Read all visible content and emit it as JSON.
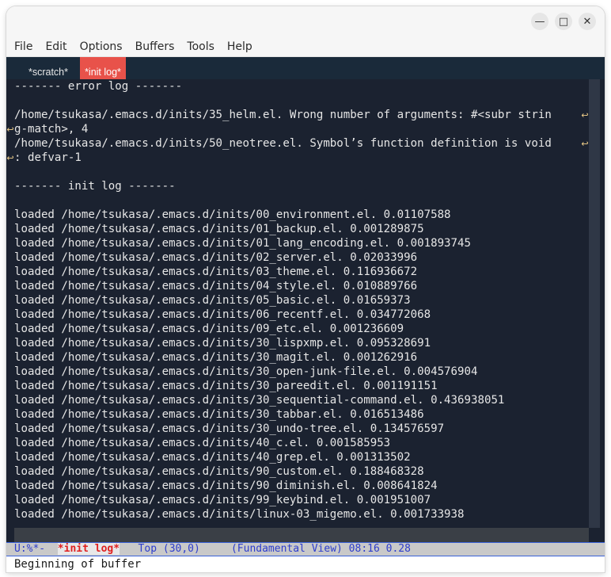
{
  "window": {
    "minimize_icon": "minimize-icon",
    "maximize_icon": "maximize-icon",
    "close_icon": "close-icon"
  },
  "menu": [
    "File",
    "Edit",
    "Options",
    "Buffers",
    "Tools",
    "Help"
  ],
  "tabs": [
    {
      "label": "*scratch*",
      "active": false
    },
    {
      "label": "*init log*",
      "active": true
    }
  ],
  "buffer": {
    "lines": [
      "------- error log -------",
      "",
      "/home/tsukasa/.emacs.d/inits/35_helm.el. Wrong number of arguments: #<subr strin",
      "g-match>, 4",
      "/home/tsukasa/.emacs.d/inits/50_neotree.el. Symbol’s function definition is void",
      ": defvar-1",
      "",
      "------- init log -------",
      "",
      "loaded /home/tsukasa/.emacs.d/inits/00_environment.el. 0.01107588",
      "loaded /home/tsukasa/.emacs.d/inits/01_backup.el. 0.001289875",
      "loaded /home/tsukasa/.emacs.d/inits/01_lang_encoding.el. 0.001893745",
      "loaded /home/tsukasa/.emacs.d/inits/02_server.el. 0.02033996",
      "loaded /home/tsukasa/.emacs.d/inits/03_theme.el. 0.116936672",
      "loaded /home/tsukasa/.emacs.d/inits/04_style.el. 0.010889766",
      "loaded /home/tsukasa/.emacs.d/inits/05_basic.el. 0.01659373",
      "loaded /home/tsukasa/.emacs.d/inits/06_recentf.el. 0.034772068",
      "loaded /home/tsukasa/.emacs.d/inits/09_etc.el. 0.001236609",
      "loaded /home/tsukasa/.emacs.d/inits/30_lispxmp.el. 0.095328691",
      "loaded /home/tsukasa/.emacs.d/inits/30_magit.el. 0.001262916",
      "loaded /home/tsukasa/.emacs.d/inits/30_open-junk-file.el. 0.004576904",
      "loaded /home/tsukasa/.emacs.d/inits/30_pareedit.el. 0.001191151",
      "loaded /home/tsukasa/.emacs.d/inits/30_sequential-command.el. 0.436938051",
      "loaded /home/tsukasa/.emacs.d/inits/30_tabbar.el. 0.016513486",
      "loaded /home/tsukasa/.emacs.d/inits/30_undo-tree.el. 0.134576597",
      "loaded /home/tsukasa/.emacs.d/inits/40_c.el. 0.001585953",
      "loaded /home/tsukasa/.emacs.d/inits/40_grep.el. 0.001313502",
      "loaded /home/tsukasa/.emacs.d/inits/90_custom.el. 0.188468328",
      "loaded /home/tsukasa/.emacs.d/inits/90_diminish.el. 0.008641824",
      "loaded /home/tsukasa/.emacs.d/inits/99_keybind.el. 0.001951007",
      "loaded /home/tsukasa/.emacs.d/inits/linux-03_migemo.el. 0.001733938"
    ],
    "wrap_marker": "↩"
  },
  "modeline": {
    "status": "U:%*-  ",
    "buffer_name": "*init log*",
    "position": "   Top (30,0)     ",
    "mode": "(Fundamental View)",
    "time": " 08:16 0.28"
  },
  "echo_area": "Beginning of buffer",
  "colors": {
    "editor_bg": "#1b2230",
    "tab_active": "#e8524a",
    "modeline_text": "#2d3dcc",
    "modeline_buffer": "#e02020"
  }
}
